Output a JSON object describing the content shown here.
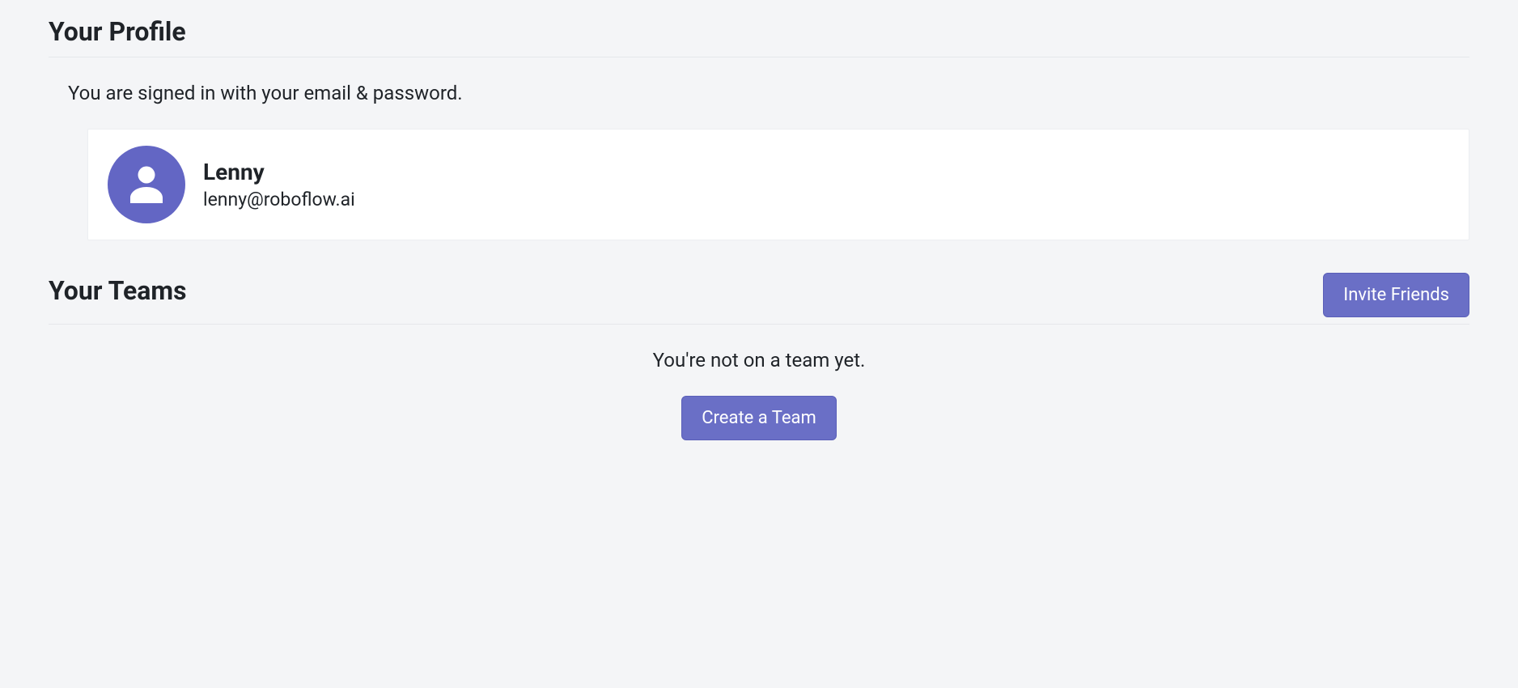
{
  "profile": {
    "heading": "Your Profile",
    "signin_text": "You are signed in with your email & password.",
    "name": "Lenny",
    "email": "lenny@roboflow.ai"
  },
  "teams": {
    "heading": "Your Teams",
    "invite_label": "Invite Friends",
    "empty_text": "You're not on a team yet.",
    "create_label": "Create a Team"
  }
}
